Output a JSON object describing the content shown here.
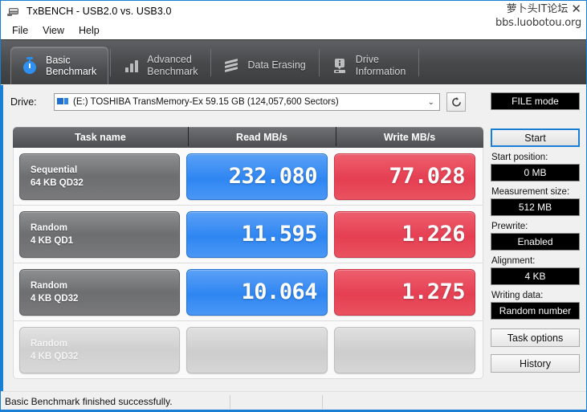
{
  "window": {
    "title": "TxBENCH - USB2.0 vs. USB3.0",
    "app_icon": "usb-plug-icon"
  },
  "watermark": {
    "line1": "萝卜头IT论坛",
    "close": "✕",
    "line2": "bbs.luobotou.org"
  },
  "menu": {
    "items": [
      {
        "label": "File"
      },
      {
        "label": "View"
      },
      {
        "label": "Help"
      }
    ]
  },
  "tabs": [
    {
      "label": "Basic\nBenchmark",
      "icon": "stopwatch-icon",
      "active": true
    },
    {
      "label": "Advanced\nBenchmark",
      "icon": "bar-chart-icon",
      "active": false
    },
    {
      "label": "Data Erasing",
      "icon": "wave-icon",
      "active": false
    },
    {
      "label": "Drive\nInformation",
      "icon": "drive-info-icon",
      "active": false
    }
  ],
  "drive": {
    "label": "Drive:",
    "selected": "(E:) TOSHIBA TransMemory-Ex  59.15 GB (124,057,600 Sectors)",
    "arrow": "⌄",
    "refresh_icon": "refresh-icon"
  },
  "table": {
    "headers": {
      "task": "Task name",
      "read": "Read MB/s",
      "write": "Write MB/s"
    },
    "rows": [
      {
        "name": "Sequential",
        "params": "64 KB QD32",
        "read": "232.080",
        "write": "77.028",
        "empty": false
      },
      {
        "name": "Random",
        "params": "4 KB QD1",
        "read": "11.595",
        "write": "1.226",
        "empty": false
      },
      {
        "name": "Random",
        "params": "4 KB QD32",
        "read": "10.064",
        "write": "1.275",
        "empty": false
      },
      {
        "name": "Random",
        "params": "4 KB QD32",
        "read": "",
        "write": "",
        "empty": true
      }
    ]
  },
  "sidebar": {
    "mode": "FILE mode",
    "start_button": "Start",
    "start_position_label": "Start position:",
    "start_position_value": "0 MB",
    "measurement_size_label": "Measurement size:",
    "measurement_size_value": "512 MB",
    "prewrite_label": "Prewrite:",
    "prewrite_value": "Enabled",
    "alignment_label": "Alignment:",
    "alignment_value": "4 KB",
    "writing_data_label": "Writing data:",
    "writing_data_value": "Random number",
    "task_options_button": "Task options",
    "history_button": "History"
  },
  "statusbar": {
    "message": "Basic Benchmark finished successfully.",
    "panel2": "",
    "panel3": ""
  },
  "colors": {
    "accent": "#1a7fd4",
    "read": "#2f86f2",
    "write": "#e53f52",
    "tab_dark": "#4b4d4f"
  }
}
